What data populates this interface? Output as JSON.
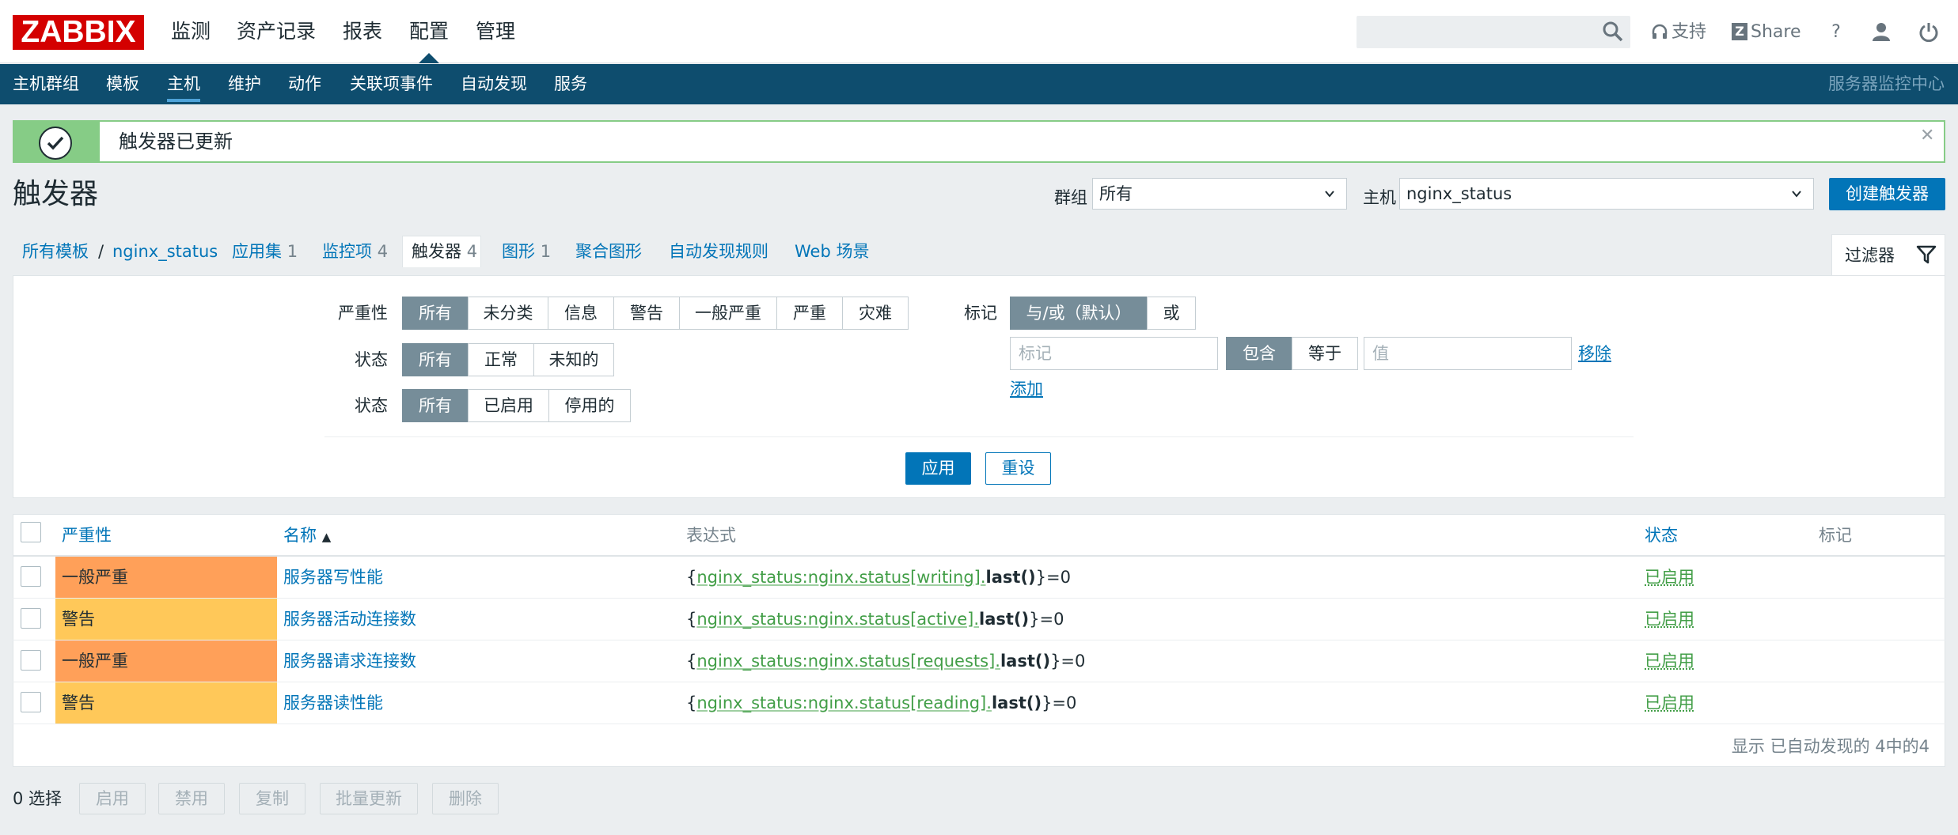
{
  "logo": "ZABBIX",
  "top_menu": [
    "监测",
    "资产记录",
    "报表",
    "配置",
    "管理"
  ],
  "top_links": {
    "support": "支持",
    "share": "Share",
    "help": "?"
  },
  "sub_menu": [
    "主机群组",
    "模板",
    "主机",
    "维护",
    "动作",
    "关联项事件",
    "自动发现",
    "服务"
  ],
  "server_name": "服务器监控中心",
  "message": "触发器已更新",
  "page_title": "触发器",
  "header": {
    "group_label": "群组",
    "group_value": "所有",
    "host_label": "主机",
    "host_value": "nginx_status",
    "create_button": "创建触发器"
  },
  "breadcrumb": {
    "all_templates": "所有模板",
    "sep": "/",
    "host": "nginx_status",
    "tabs": [
      {
        "label": "应用集",
        "count": "1"
      },
      {
        "label": "监控项",
        "count": "4"
      },
      {
        "label": "触发器",
        "count": "4"
      },
      {
        "label": "图形",
        "count": "1"
      },
      {
        "label": "聚合图形",
        "count": ""
      },
      {
        "label": "自动发现规则",
        "count": ""
      },
      {
        "label": "Web 场景",
        "count": ""
      }
    ],
    "filter_tab": "过滤器"
  },
  "filter": {
    "severity_label": "严重性",
    "severity_options": [
      "所有",
      "未分类",
      "信息",
      "警告",
      "一般严重",
      "严重",
      "灾难"
    ],
    "state_label": "状态",
    "state_options": [
      "所有",
      "正常",
      "未知的"
    ],
    "status_label": "状态",
    "status_options": [
      "所有",
      "已启用",
      "停用的"
    ],
    "tags_label": "标记",
    "tags_eval_options": [
      "与/或（默认）",
      "或"
    ],
    "tag_placeholder": "标记",
    "tag_op_options": [
      "包含",
      "等于"
    ],
    "value_placeholder": "值",
    "remove_link": "移除",
    "add_link": "添加",
    "apply_button": "应用",
    "reset_button": "重设"
  },
  "table": {
    "headers": {
      "severity": "严重性",
      "name": "名称",
      "name_sort": "▲",
      "expression": "表达式",
      "status": "状态",
      "tags": "标记"
    },
    "rows": [
      {
        "severity": "一般严重",
        "severity_color": "#ffa059",
        "name": "服务器写性能",
        "expr_open": "{",
        "expr_key": "nginx_status:nginx.status[writing]",
        "expr_dot": ".",
        "expr_func": "last()",
        "expr_close": "}=0",
        "status": "已启用"
      },
      {
        "severity": "警告",
        "severity_color": "#ffc859",
        "name": "服务器活动连接数",
        "expr_open": "{",
        "expr_key": "nginx_status:nginx.status[active]",
        "expr_dot": ".",
        "expr_func": "last()",
        "expr_close": "}=0",
        "status": "已启用"
      },
      {
        "severity": "一般严重",
        "severity_color": "#ffa059",
        "name": "服务器请求连接数",
        "expr_open": "{",
        "expr_key": "nginx_status:nginx.status[requests]",
        "expr_dot": ".",
        "expr_func": "last()",
        "expr_close": "}=0",
        "status": "已启用"
      },
      {
        "severity": "警告",
        "severity_color": "#ffc859",
        "name": "服务器读性能",
        "expr_open": "{",
        "expr_key": "nginx_status:nginx.status[reading]",
        "expr_dot": ".",
        "expr_func": "last()",
        "expr_close": "}=0",
        "status": "已启用"
      }
    ],
    "footer": "显示 已自动发现的 4中的4"
  },
  "actions": {
    "selected": "0 选择",
    "buttons": [
      "启用",
      "禁用",
      "复制",
      "批量更新",
      "删除"
    ]
  }
}
